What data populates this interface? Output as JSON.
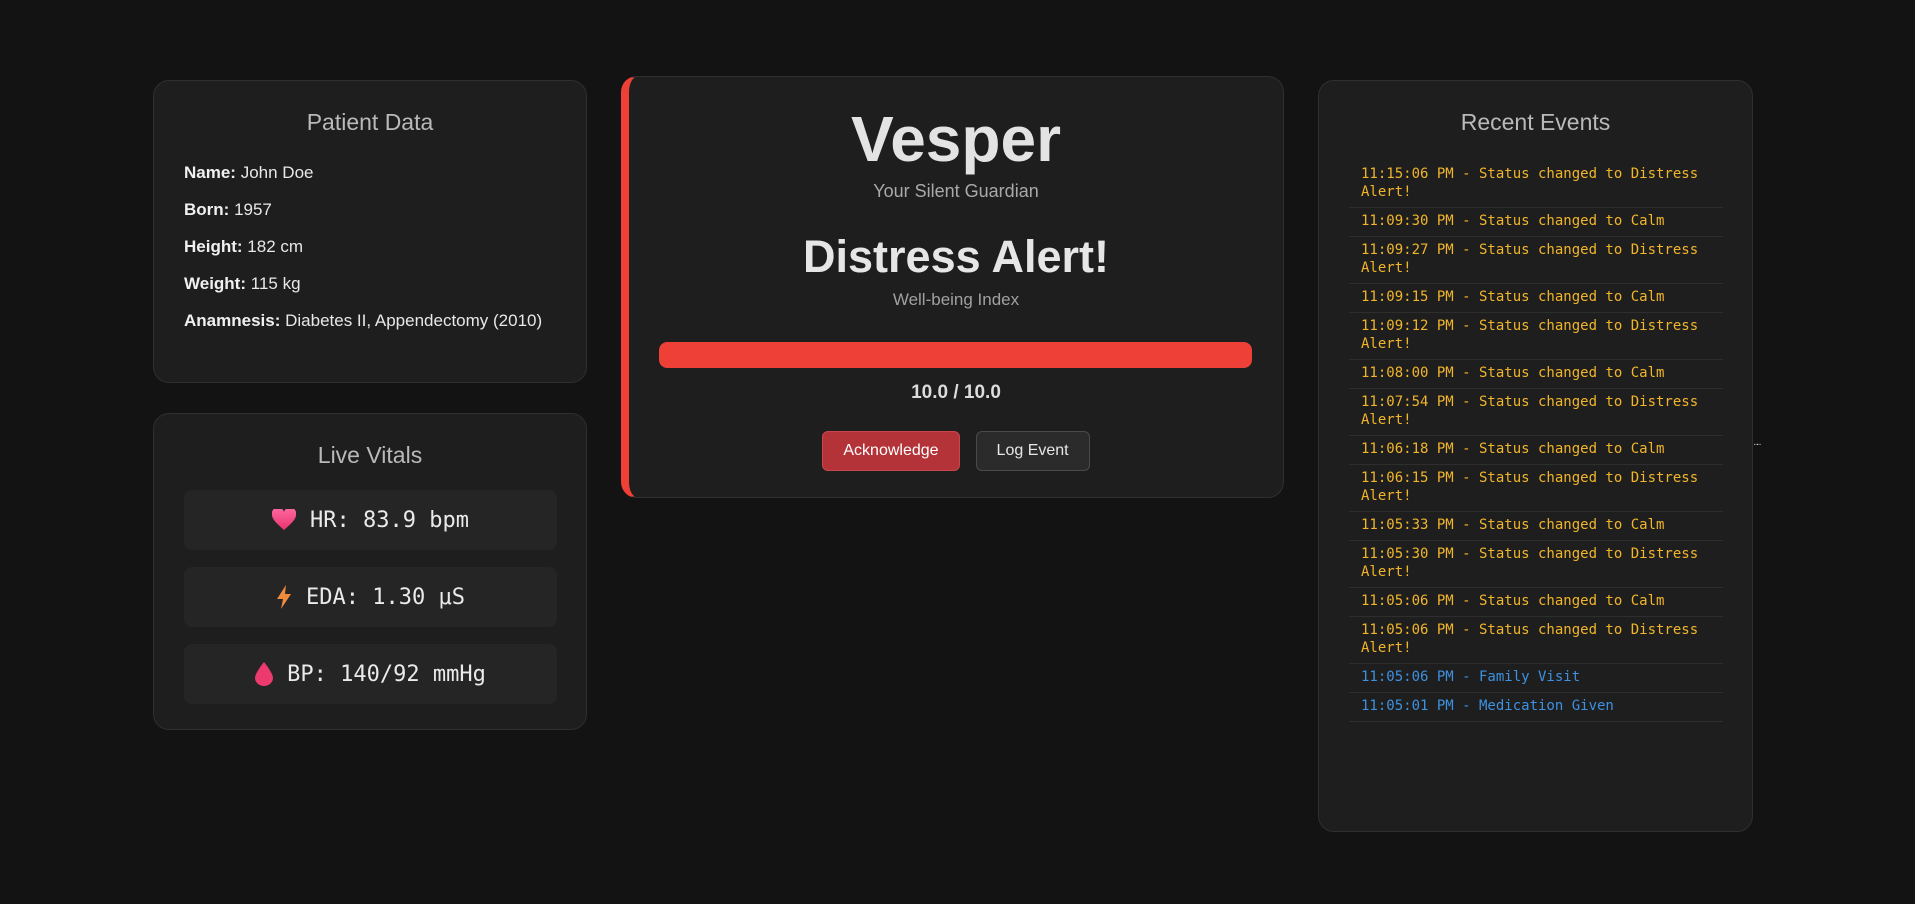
{
  "patient": {
    "title": "Patient Data",
    "fields": [
      {
        "label": "Name:",
        "value": "John Doe"
      },
      {
        "label": "Born:",
        "value": "1957"
      },
      {
        "label": "Height:",
        "value": "182 cm"
      },
      {
        "label": "Weight:",
        "value": "115 kg"
      },
      {
        "label": "Anamnesis:",
        "value": "Diabetes II, Appendectomy (2010)"
      }
    ]
  },
  "vitals": {
    "title": "Live Vitals",
    "hr": {
      "icon": "heart-icon",
      "text": "HR: 83.9 bpm"
    },
    "eda": {
      "icon": "lightning-icon",
      "text": "EDA: 1.30 μS"
    },
    "bp": {
      "icon": "blood-drop-icon",
      "text": "BP: 140/92 mmHg"
    }
  },
  "status": {
    "brand": "Vesper",
    "tagline": "Your Silent Guardian",
    "title": "Distress Alert!",
    "index_label": "Well-being Index",
    "index_value": 10.0,
    "index_max": 10.0,
    "score_text": "10.0 / 10.0",
    "accent_color": "#ee4037",
    "acknowledge_label": "Acknowledge",
    "log_event_label": "Log Event"
  },
  "events": {
    "title": "Recent Events",
    "items": [
      {
        "text": "11:15:06 PM - Status changed to Distress Alert!",
        "type": "status"
      },
      {
        "text": "11:09:30 PM - Status changed to Calm",
        "type": "status"
      },
      {
        "text": "11:09:27 PM - Status changed to Distress Alert!",
        "type": "status"
      },
      {
        "text": "11:09:15 PM - Status changed to Calm",
        "type": "status"
      },
      {
        "text": "11:09:12 PM - Status changed to Distress Alert!",
        "type": "status"
      },
      {
        "text": "11:08:00 PM - Status changed to Calm",
        "type": "status"
      },
      {
        "text": "11:07:54 PM - Status changed to Distress Alert!",
        "type": "status"
      },
      {
        "text": "11:06:18 PM - Status changed to Calm",
        "type": "status"
      },
      {
        "text": "11:06:15 PM - Status changed to Distress Alert!",
        "type": "status"
      },
      {
        "text": "11:05:33 PM - Status changed to Calm",
        "type": "status"
      },
      {
        "text": "11:05:30 PM - Status changed to Distress Alert!",
        "type": "status"
      },
      {
        "text": "11:05:06 PM - Status changed to Calm",
        "type": "status"
      },
      {
        "text": "11:05:06 PM - Status changed to Distress Alert!",
        "type": "status"
      },
      {
        "text": "11:05:06 PM - Family Visit",
        "type": "info"
      },
      {
        "text": "11:05:01 PM - Medication Given",
        "type": "info"
      }
    ],
    "status_color": "#f1b52b",
    "info_color": "#3d91e0"
  },
  "stray_mark": "¨¨"
}
